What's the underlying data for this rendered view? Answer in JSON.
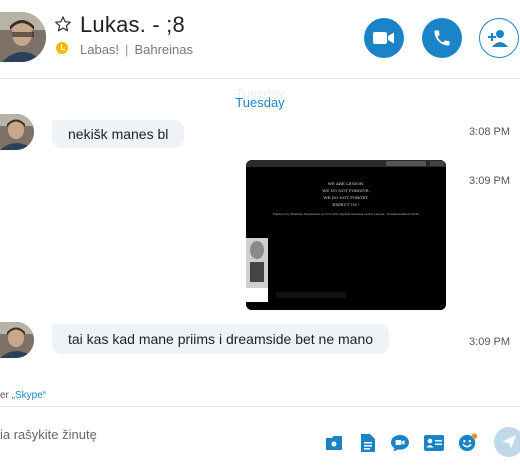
{
  "header": {
    "contact_name": "Lukas. - ;8",
    "mood_message": "Labas!",
    "separator": "|",
    "location": "Bahreinas"
  },
  "conversation": {
    "day_ghost": "Tuesday",
    "day_label": "Tuesday",
    "messages": [
      {
        "type": "text",
        "text": "nekišk manes bl",
        "time": "3:08 PM"
      },
      {
        "type": "image",
        "time": "3:09 PM",
        "image_lines": [
          "WE ARE LEGION.",
          "WE DO NOT FORGIVE.",
          "WE DO NOT FORGET.",
          "EXPECT US !",
          "Hacked by Shaman Dreamside.eu.8 Norint atgauti Sistema rasiol į skype : liveslaunukevicius56"
        ],
        "browser_tab": "dreamside.eu"
      },
      {
        "type": "text",
        "text": "tai kas kad mane priims i dreamside bet ne mano",
        "time": "3:09 PM"
      }
    ]
  },
  "footer": {
    "label_prefix": "er ",
    "label_link": "„Skype“"
  },
  "composer": {
    "placeholder": "ia rašykite žinutę"
  },
  "colors": {
    "accent": "#1b84c7",
    "presence_away": "#f8b900",
    "bubble": "#eef3f8",
    "emoji": "#1b84c7",
    "notification": "#f28a30"
  }
}
